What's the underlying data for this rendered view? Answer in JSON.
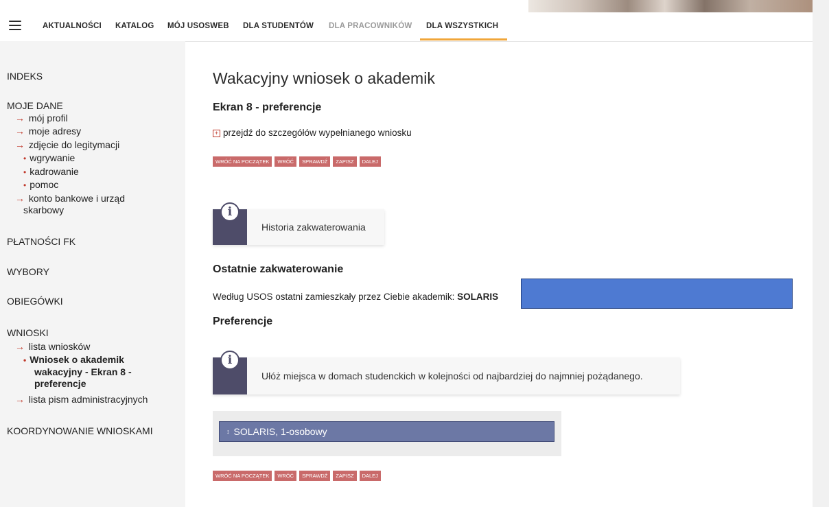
{
  "nav": {
    "items": [
      {
        "label": "AKTUALNOŚCI"
      },
      {
        "label": "KATALOG"
      },
      {
        "label": "MÓJ USOSWEB"
      },
      {
        "label": "DLA STUDENTÓW"
      },
      {
        "label": "DLA PRACOWNIKÓW"
      },
      {
        "label": "DLA WSZYSTKICH"
      }
    ],
    "active": "DLA WSZYSTKICH"
  },
  "sidebar": {
    "indeks": "INDEKS",
    "moje_dane": "MOJE DANE",
    "moje_dane_links": [
      "mój profil",
      "moje adresy",
      "zdjęcie do legitymacji"
    ],
    "zdjecie_sub": [
      "wgrywanie",
      "kadrowanie",
      "pomoc"
    ],
    "konto_line1": "konto bankowe i urząd",
    "konto_line2": "skarbowy",
    "platnosci": "PŁATNOŚCI FK",
    "wybory": "WYBORY",
    "obiegowki": "OBIEGÓWKI",
    "wnioski": "WNIOSKI",
    "lista_wnioskow": "lista wniosków",
    "active_line1": "Wniosek o akademik",
    "active_line2": "wakacyjny - Ekran 8 -",
    "active_line3": "preferencje",
    "lista_pism": "lista pism administracyjnych",
    "koordynowanie": "KOORDYNOWANIE WNIOSKAMI"
  },
  "main": {
    "title": "Wakacyjny wniosek o akademik",
    "subtitle": "Ekran 8 - preferencje",
    "expand_link": "przejdź do szczegółów wypełnianego wniosku",
    "buttons": [
      "WRÓĆ NA POCZĄTEK",
      "WRÓĆ",
      "SPRAWDŹ",
      "ZAPISZ",
      "DALEJ"
    ],
    "info1": "Historia zakwaterowania",
    "last_heading": "Ostatnie zakwaterowanie",
    "last_text": "Według USOS ostatni zamieszkały przez Ciebie akademik: ",
    "last_value": "SOLARIS",
    "pref_heading": "Preferencje",
    "info2": "Ułóż miejsca w domach studenckich w kolejności od najbardziej do najmniej pożądanego.",
    "pref_item": "SOLARIS, 1-osobowy"
  },
  "colors": {
    "accent": "#f0a63a",
    "button": "#c96a6a",
    "info_icon": "#4e4c69",
    "pref_item": "#6c78a5",
    "redaction": "#4e7ad2"
  },
  "icons": {
    "menu": "hamburger-icon",
    "info": "info-icon",
    "expand": "plus-box-icon",
    "drag": "drag-handle-icon"
  }
}
